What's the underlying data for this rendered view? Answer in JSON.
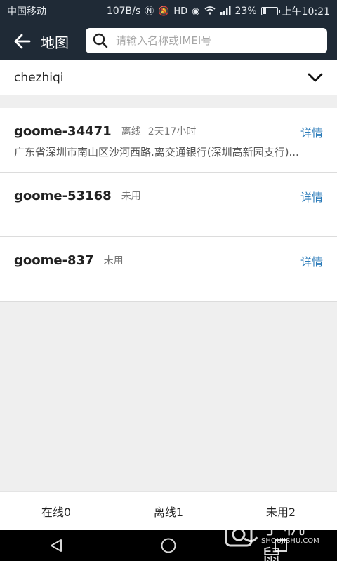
{
  "status_bar": {
    "carrier": "中国移动",
    "speed": "107B/s",
    "battery_percent": "23%",
    "battery_level": 0.23,
    "time": "上午10:21"
  },
  "header": {
    "title": "地图",
    "search_placeholder": "请输入名称或IMEI号",
    "search_value": ""
  },
  "group": {
    "selected": "chezhiqi"
  },
  "devices": [
    {
      "name": "goome-34471",
      "status": "离线",
      "duration": "2天17小时",
      "address": "广东省深圳市南山区沙河西路.离交通银行(深圳高新园支行)...",
      "detail_label": "详情"
    },
    {
      "name": "goome-53168",
      "status": "未用",
      "duration": "",
      "address": "",
      "detail_label": "详情"
    },
    {
      "name": "goome-837",
      "status": "未用",
      "duration": "",
      "address": "",
      "detail_label": "详情"
    }
  ],
  "tabs": [
    {
      "label": "在线0"
    },
    {
      "label": "离线1"
    },
    {
      "label": "未用2"
    }
  ],
  "watermark": {
    "text": "手机鼠",
    "sub": "SHOUJISHU.COM"
  },
  "colors": {
    "header_bg": "#1f2a36",
    "link": "#2a7ab8",
    "page_bg": "#efefef"
  }
}
